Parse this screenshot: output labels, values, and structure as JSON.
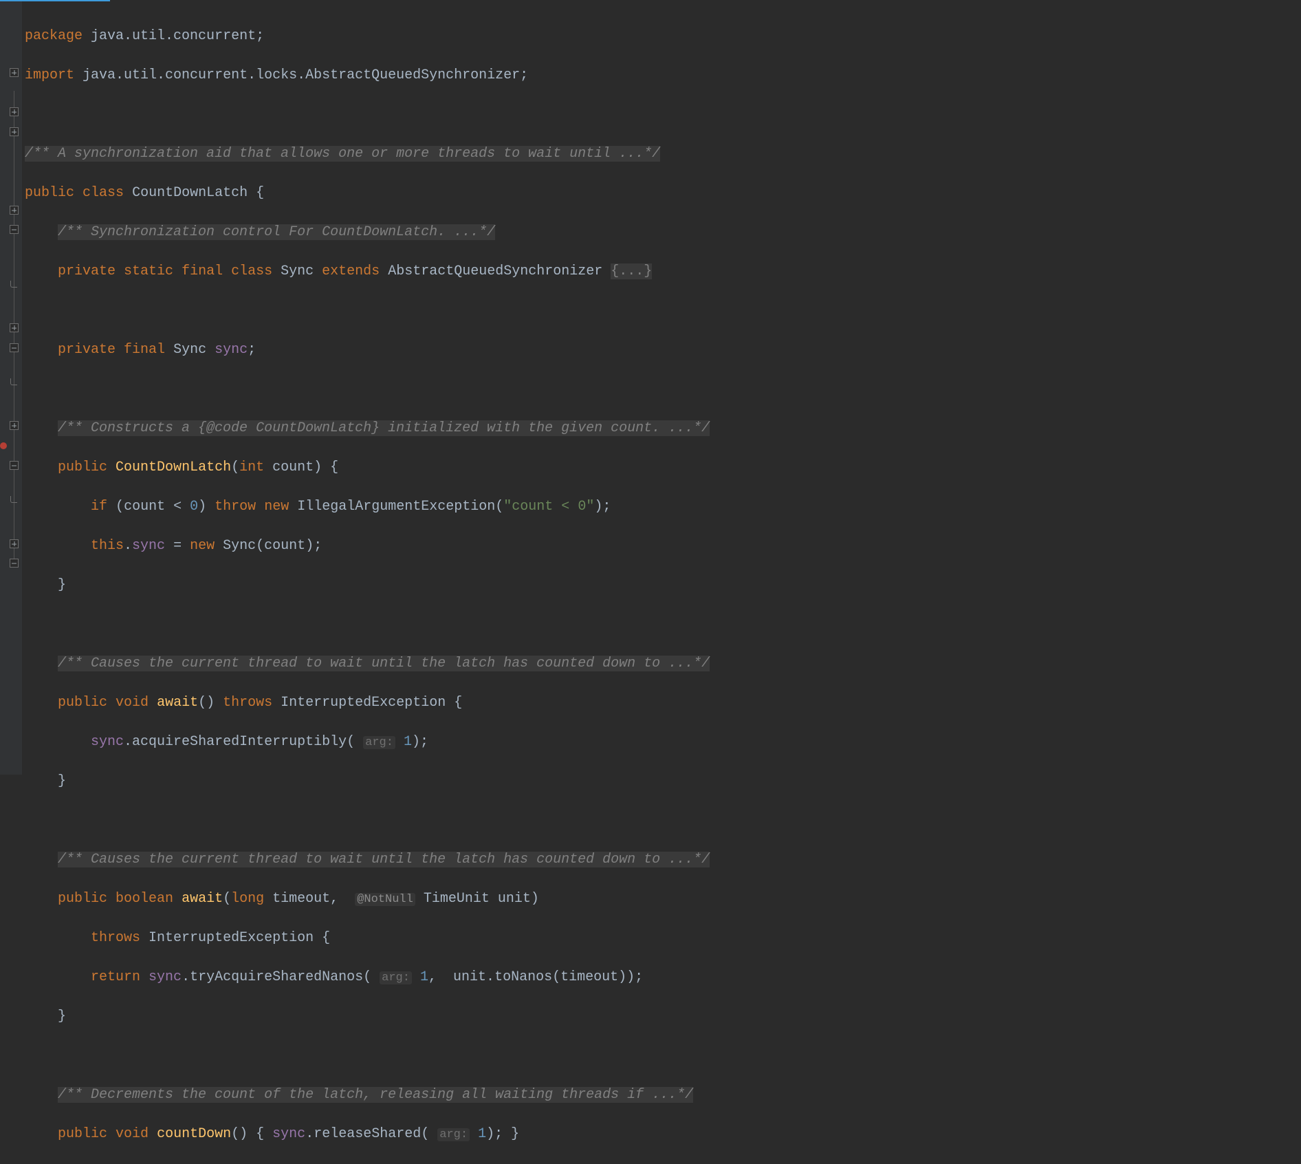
{
  "code": {
    "l1": {
      "kw1": "package",
      "pkg": "java.util.concurrent",
      "semi": ";"
    },
    "l2": {
      "kw1": "import",
      "pkg": "java.util.concurrent.locks.AbstractQueuedSynchronizer",
      "semi": ";"
    },
    "l4": {
      "c": "/** A synchronization aid that allows one or more threads to wait until ...*/"
    },
    "l5": {
      "kw1": "public",
      "kw2": "class",
      "name": "CountDownLatch",
      "brace": "{"
    },
    "l6": {
      "c": "/** Synchronization control For CountDownLatch. ...*/"
    },
    "l7": {
      "kw1": "private",
      "kw2": "static",
      "kw3": "final",
      "kw4": "class",
      "name": "Sync",
      "kw5": "extends",
      "sup": "AbstractQueuedSynchronizer",
      "fold": "{...}"
    },
    "l9": {
      "kw1": "private",
      "kw2": "final",
      "type": "Sync",
      "field": "sync",
      "semi": ";"
    },
    "l11": {
      "c": "/** Constructs a {@code CountDownLatch} initialized with the given count. ...*/"
    },
    "l12": {
      "kw1": "public",
      "name": "CountDownLatch",
      "lp": "(",
      "kw2": "int",
      "param": "count",
      "rp": ")",
      "brace": "{"
    },
    "l13": {
      "kw1": "if",
      "lp": "(",
      "v": "count",
      "op": "<",
      "n": "0",
      "rp": ")",
      "kw2": "throw",
      "kw3": "new",
      "ex": "IllegalArgumentException",
      "lp2": "(",
      "s": "\"count < 0\"",
      "rp2": ")",
      "semi": ";"
    },
    "l14": {
      "kw1": "this",
      "dot": ".",
      "field": "sync",
      "eq": "=",
      "kw2": "new",
      "ctor": "Sync",
      "lp": "(",
      "arg": "count",
      "rp": ")",
      "semi": ";"
    },
    "l15": {
      "brace": "}"
    },
    "l17": {
      "c": "/** Causes the current thread to wait until the latch has counted down to ...*/"
    },
    "l18": {
      "kw1": "public",
      "kw2": "void",
      "name": "await",
      "paren": "()",
      "kw3": "throws",
      "ex": "InterruptedException",
      "brace": "{"
    },
    "l19": {
      "field": "sync",
      "dot": ".",
      "m": "acquireSharedInterruptibly",
      "lp": "(",
      "hint": "arg:",
      "n": "1",
      "rp": ")",
      "semi": ";"
    },
    "l20": {
      "brace": "}"
    },
    "l22": {
      "c": "/** Causes the current thread to wait until the latch has counted down to ...*/"
    },
    "l23": {
      "kw1": "public",
      "kw2": "boolean",
      "name": "await",
      "lp": "(",
      "kw3": "long",
      "p1": "timeout",
      "comma": ",",
      "ann": "@NotNull",
      "type2": "TimeUnit",
      "p2": "unit",
      "rp": ")"
    },
    "l24": {
      "kw1": "throws",
      "ex": "InterruptedException",
      "brace": "{"
    },
    "l25": {
      "kw1": "return",
      "field": "sync",
      "dot": ".",
      "m": "tryAcquireSharedNanos",
      "lp": "(",
      "hint": "arg:",
      "n": "1",
      "comma": ",",
      "arg2a": "unit",
      "dot2": ".",
      "m2": "toNanos",
      "lp2": "(",
      "arg2b": "timeout",
      "rp2": ")",
      "rp": ")",
      "semi": ";"
    },
    "l26": {
      "brace": "}"
    },
    "l28": {
      "c": "/** Decrements the count of the latch, releasing all waiting threads if ...*/"
    },
    "l29": {
      "kw1": "public",
      "kw2": "void",
      "name": "countDown",
      "paren": "()",
      "brace1": "{",
      "field": "sync",
      "dot": ".",
      "m": "releaseShared",
      "lp": "(",
      "hint": "arg:",
      "n": "1",
      "rp": ")",
      "semi": ";",
      "brace2": "}"
    }
  },
  "indent": {
    "i1": "    ",
    "i2": "        "
  }
}
